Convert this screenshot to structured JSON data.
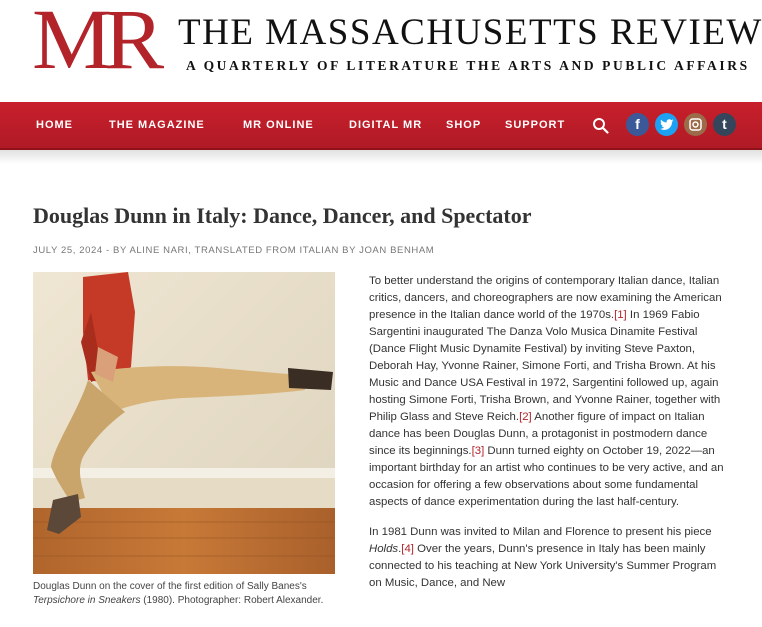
{
  "header": {
    "logo": "MR",
    "title": "THE MASSACHUSETTS REVIEW",
    "tagline": "A QUARTERLY OF LITERATURE THE ARTS AND PUBLIC AFFAIRS"
  },
  "nav": {
    "items": [
      "HOME",
      "THE MAGAZINE",
      "MR ONLINE",
      "DIGITAL MR",
      "SHOP",
      "SUPPORT"
    ],
    "social": [
      {
        "icon": "facebook-icon",
        "glyph": "f",
        "color": "#3b5998"
      },
      {
        "icon": "twitter-icon",
        "glyph": "t",
        "color": "#1da1f2"
      },
      {
        "icon": "instagram-icon",
        "glyph": "◙",
        "color": "#9b6b4a"
      },
      {
        "icon": "tumblr-icon",
        "glyph": "t",
        "color": "#35465c"
      }
    ]
  },
  "article": {
    "title": "Douglas Dunn in Italy: Dance, Dancer, and Spectator",
    "date": "JULY 25, 2024",
    "by_prefix": " - BY ",
    "author": "ALINE NARI",
    "translator_prefix": ", TRANSLATED FROM ITALIAN BY ",
    "translator": "JOAN BENHAM",
    "caption_a": "Douglas Dunn on the cover of the first edition of Sally Banes's ",
    "caption_em": "Terpsichore in Sneakers",
    "caption_b": " (1980). Photographer: Robert Alexander.",
    "p1": {
      "a": "To better understand the origins of contemporary Italian dance, Italian critics, dancers, and choreographers are now examining the American presence in the Italian dance world of the 1970s.",
      "fn1": "[1]",
      "b": " In 1969 Fabio Sargentini inaugurated The Danza Volo Musica Dinamite Festival (Dance Flight Music Dynamite Festival) by inviting Steve Paxton, Deborah Hay, Yvonne Rainer, Simone Forti, and Trisha Brown. At his Music and Dance USA Festival in 1972, Sargentini followed up, again hosting Simone Forti, Trisha Brown, and Yvonne Rainer, together with Philip Glass and Steve Reich.",
      "fn2": "[2]",
      "c": " Another figure of impact on Italian dance has been Douglas Dunn, a protagonist in postmodern dance since its beginnings.",
      "fn3": "[3]",
      "d": " Dunn turned eighty on October 19, 2022—an important birthday for an artist who continues to be very active, and an occasion for offering a few observations about some fundamental aspects of dance experimentation during the last half-century."
    },
    "p2": {
      "a": "In 1981 Dunn was invited to Milan and Florence to present his piece ",
      "em": "Holds",
      "dot": ".",
      "fn4": "[4]",
      "b": " Over the years, Dunn's presence in Italy has been mainly connected to his teaching at New York University's Summer Program on Music, Dance, and New"
    }
  }
}
